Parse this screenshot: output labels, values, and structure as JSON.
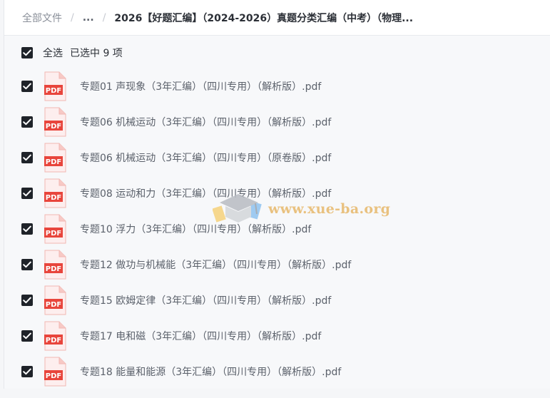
{
  "breadcrumb": {
    "root": "全部文件",
    "separator": "/",
    "ellipsis": "...",
    "current": "2026【好题汇编】（2024-2026）真题分类汇编（中考）（物理..."
  },
  "selection": {
    "label": "全选",
    "count_text": "已选中  9  项",
    "all_checked": true
  },
  "files": [
    {
      "name": "专题01 声现象（3年汇编）（四川专用）（解析版）.pdf",
      "checked": true,
      "icon": "pdf-icon"
    },
    {
      "name": "专题06 机械运动（3年汇编）（四川专用）（解析版）.pdf",
      "checked": true,
      "icon": "pdf-icon"
    },
    {
      "name": "专题06 机械运动（3年汇编）（四川专用）（原卷版）.pdf",
      "checked": true,
      "icon": "pdf-icon"
    },
    {
      "name": "专题08 运动和力（3年汇编）（四川专用）（解析版）.pdf",
      "checked": true,
      "icon": "pdf-icon"
    },
    {
      "name": "专题10 浮力（3年汇编）（四川专用）（解析版）.pdf",
      "checked": true,
      "icon": "pdf-icon"
    },
    {
      "name": "专题12 做功与机械能（3年汇编）（四川专用）（解析版）.pdf",
      "checked": true,
      "icon": "pdf-icon"
    },
    {
      "name": "专题15 欧姆定律（3年汇编）（四川专用）（解析版）.pdf",
      "checked": true,
      "icon": "pdf-icon"
    },
    {
      "name": "专题17 电和磁（3年汇编）（四川专用）（解析版）.pdf",
      "checked": true,
      "icon": "pdf-icon"
    },
    {
      "name": "专题18 能量和能源（3年汇编）（四川专用）（解析版）.pdf",
      "checked": true,
      "icon": "pdf-icon"
    }
  ],
  "pdf_badge": "PDF",
  "watermark": {
    "text": "www.xue-ba.org"
  },
  "colors": {
    "checkbox": "#1f2329",
    "pdf_red": "#e8453c",
    "watermark": "#e7b86a"
  }
}
